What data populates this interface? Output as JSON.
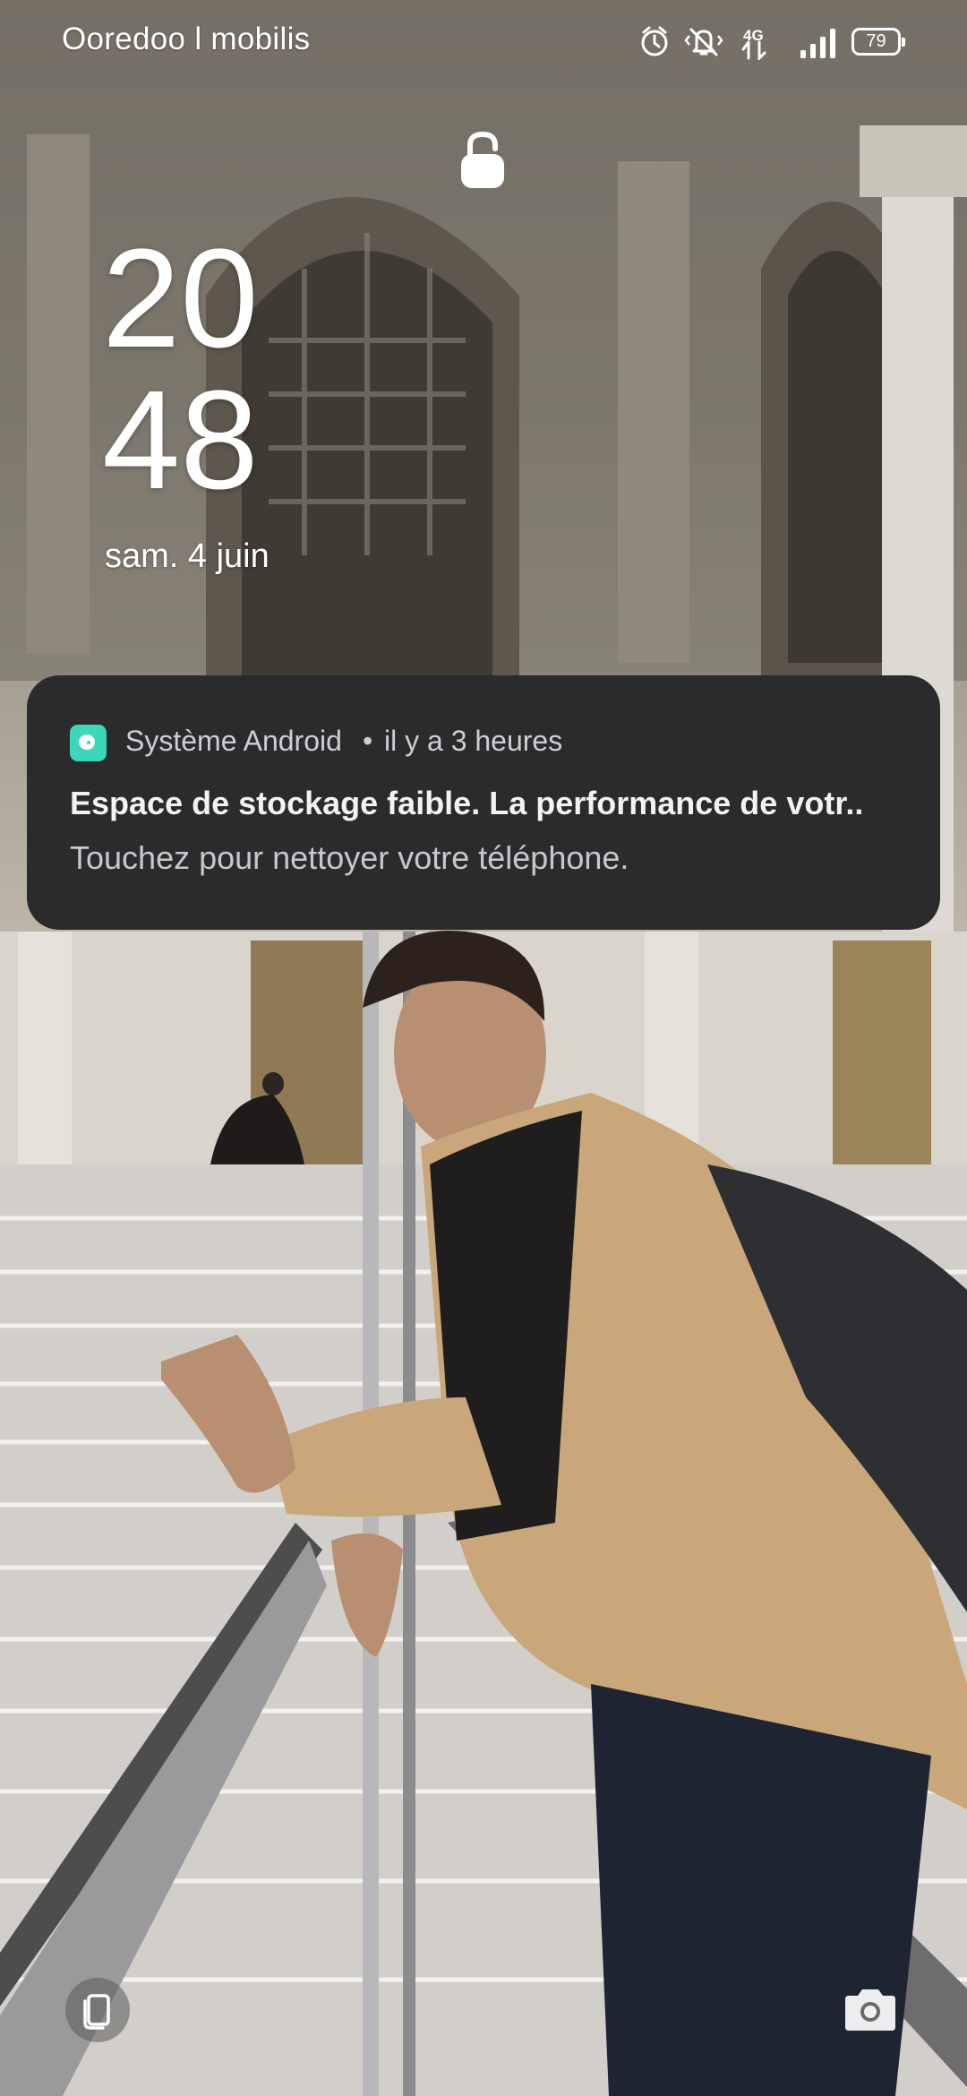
{
  "status_bar": {
    "carrier": "Ooredoo l mobilis",
    "network_type": "4G",
    "battery_level": "79",
    "icons": [
      "alarm-icon",
      "vibrate-icon",
      "data-arrows-icon",
      "signal-icon",
      "battery-icon"
    ]
  },
  "lock_screen": {
    "lock_icon": "lock-icon",
    "clock_hours": "20",
    "clock_minutes": "48",
    "date": "sam. 4 juin"
  },
  "notification": {
    "app_icon": "cleaner-icon",
    "app_name": "Système Android",
    "separator": "•",
    "time": "il y a 3 heures",
    "title": "Espace de stockage faible. La performance de votr..",
    "text": "Touchez pour nettoyer votre téléphone.",
    "accent_color": "#3dd6b8"
  },
  "shortcuts": {
    "left_icon": "phone-clone-icon",
    "right_icon": "camera-icon"
  }
}
